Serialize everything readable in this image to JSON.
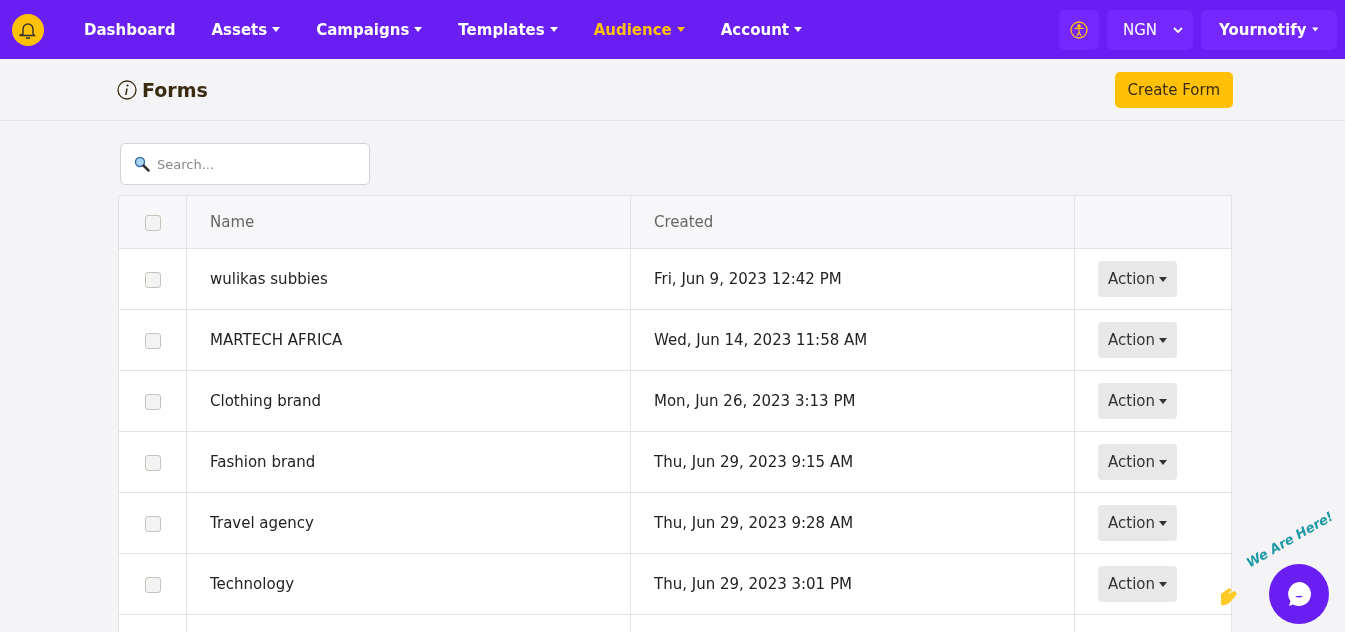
{
  "nav": {
    "items": [
      {
        "label": "Dashboard",
        "dropdown": false,
        "selected": false
      },
      {
        "label": "Assets",
        "dropdown": true,
        "selected": false
      },
      {
        "label": "Campaigns",
        "dropdown": true,
        "selected": false
      },
      {
        "label": "Templates",
        "dropdown": true,
        "selected": false
      },
      {
        "label": "Audience",
        "dropdown": true,
        "selected": true
      },
      {
        "label": "Account",
        "dropdown": true,
        "selected": false
      }
    ],
    "currency": "NGN",
    "account": "Yournotify"
  },
  "page": {
    "title": "Forms",
    "create_button": "Create Form"
  },
  "search": {
    "placeholder": "Search..."
  },
  "table": {
    "columns": [
      "Name",
      "Created"
    ],
    "select_all_checked": false,
    "rows": [
      {
        "name": "wulikas subbies",
        "created": "Fri, Jun 9, 2023 12:42 PM",
        "action": "Action",
        "checked": false
      },
      {
        "name": "MARTECH AFRICA",
        "created": "Wed, Jun 14, 2023 11:58 AM",
        "action": "Action",
        "checked": false
      },
      {
        "name": "Clothing brand",
        "created": "Mon, Jun 26, 2023 3:13 PM",
        "action": "Action",
        "checked": false
      },
      {
        "name": "Fashion brand",
        "created": "Thu, Jun 29, 2023 9:15 AM",
        "action": "Action",
        "checked": false
      },
      {
        "name": "Travel agency",
        "created": "Thu, Jun 29, 2023 9:28 AM",
        "action": "Action",
        "checked": false
      },
      {
        "name": "Technology",
        "created": "Thu, Jun 29, 2023 3:01 PM",
        "action": "Action",
        "checked": false
      }
    ]
  },
  "chat_widget": {
    "label": "We Are Here!"
  }
}
